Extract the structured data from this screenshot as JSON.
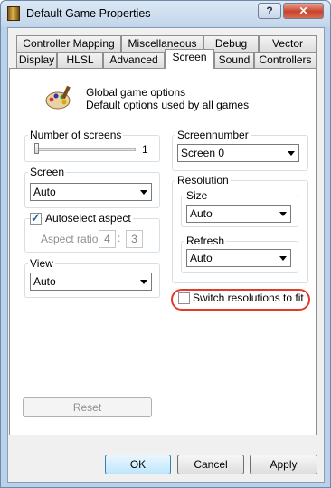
{
  "window": {
    "title": "Default Game Properties",
    "help_label": "?",
    "close_label": "✕"
  },
  "tabs_row1": [
    "Controller Mapping",
    "Miscellaneous",
    "Debug",
    "Vector"
  ],
  "tabs_row2": [
    "Display",
    "HLSL",
    "Advanced",
    "Screen",
    "Sound",
    "Controllers"
  ],
  "active_tab": "Screen",
  "header": {
    "line1": "Global game options",
    "line2": "Default options used by all games"
  },
  "number_of_screens": {
    "label": "Number of screens",
    "value": "1"
  },
  "screennumber": {
    "label": "Screennumber",
    "selected": "Screen 0"
  },
  "screen": {
    "label": "Screen",
    "selected": "Auto"
  },
  "resolution": {
    "label": "Resolution",
    "size_label": "Size",
    "size_selected": "Auto",
    "refresh_label": "Refresh",
    "refresh_selected": "Auto"
  },
  "autoselect_aspect": {
    "label": "Autoselect aspect",
    "checked": true
  },
  "aspect_ratio": {
    "label": "Aspect ratio",
    "w": "4",
    "sep": ":",
    "h": "3"
  },
  "view": {
    "label": "View",
    "selected": "Auto"
  },
  "switch_res": {
    "label": "Switch resolutions to fit",
    "checked": false
  },
  "buttons": {
    "reset": "Reset",
    "ok": "OK",
    "cancel": "Cancel",
    "apply": "Apply"
  },
  "colors": {
    "highlight": "#e23a2a",
    "check": "#2a5fa8"
  }
}
